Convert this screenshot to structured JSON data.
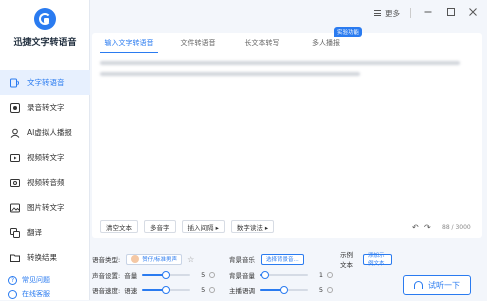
{
  "app": {
    "brand": "迅捷文字转语音"
  },
  "sidebar": {
    "items": [
      {
        "label": "文字转语音",
        "active": true,
        "icon": "text-to-speech-icon"
      },
      {
        "label": "录音转文字",
        "active": false,
        "icon": "recording-icon"
      },
      {
        "label": "AI虚拟人播报",
        "active": false,
        "icon": "ai-avatar-icon"
      },
      {
        "label": "视频转文字",
        "active": false,
        "icon": "video-icon"
      },
      {
        "label": "视频转音频",
        "active": false,
        "icon": "video-audio-icon"
      },
      {
        "label": "图片转文字",
        "active": false,
        "icon": "image-icon"
      },
      {
        "label": "翻译",
        "active": false,
        "icon": "translate-icon"
      },
      {
        "label": "转换结果",
        "active": false,
        "icon": "folder-icon"
      }
    ],
    "footer": [
      {
        "label": "常见问题"
      },
      {
        "label": "在线客服"
      }
    ]
  },
  "topbar": {
    "more_label": "更多"
  },
  "tabs": [
    {
      "label": "输入文字转语音",
      "active": true
    },
    {
      "label": "文件转语音",
      "active": false
    },
    {
      "label": "长文本转写",
      "active": false
    },
    {
      "label": "多人播报",
      "active": false,
      "badge": "实验功能"
    }
  ],
  "toolbar": {
    "buttons": [
      "清空文本",
      "多音字",
      "插入间隔 ▸",
      "数字读法 ▸"
    ],
    "counter": "88 / 3000"
  },
  "settings": {
    "voice_type_label": "语音类型:",
    "voice_name": "赞仔/标准男声",
    "bg_music_label": "背景音乐",
    "bg_music_button": "选择背景音...",
    "sample_label": "示例文本",
    "sample_button": "添加示例文本",
    "voice_settings_label": "声音设置:",
    "volume_label": "音量",
    "volume_value": "5",
    "bg_volume_label": "背景音量",
    "bg_volume_value": "1",
    "speed_label": "语音速度:",
    "speed_sub_label": "语速",
    "speed_value": "5",
    "pitch_label": "主播语调",
    "pitch_value": "5"
  },
  "try_button": "试听一下",
  "colors": {
    "accent": "#2a7bf0",
    "active_bg": "#e7f0fe"
  }
}
